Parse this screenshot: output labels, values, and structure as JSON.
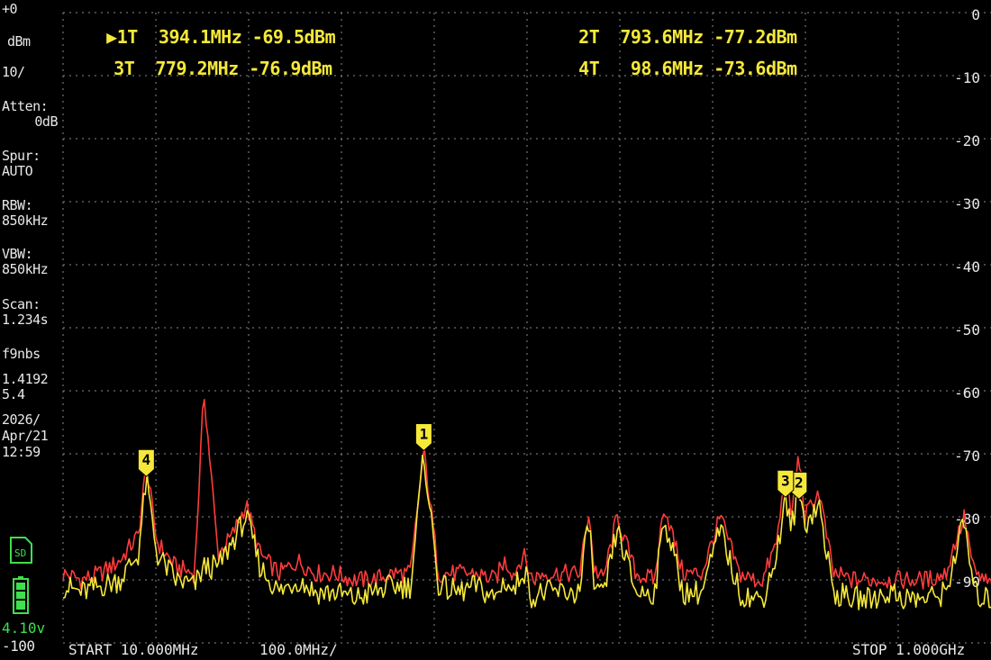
{
  "colors": {
    "background": "#000000",
    "grid": "#8a8a8a",
    "trace_yellow": "#f5e83a",
    "trace_red": "#ff3b3b",
    "marker_fill": "#f5e83a",
    "text": "#e8e8e8",
    "green": "#3ee04e"
  },
  "markers_header": [
    {
      "label": "1T",
      "freq": "394.1MHz",
      "level": "-69.5dBm",
      "selected": true
    },
    {
      "label": "2T",
      "freq": "793.6MHz",
      "level": "-77.2dBm"
    },
    {
      "label": "3T",
      "freq": "779.2MHz",
      "level": "-76.9dBm"
    },
    {
      "label": "4T",
      "freq": "98.6MHz",
      "level": "-73.6dBm"
    }
  ],
  "sidebar": {
    "ref_level": "+0",
    "unit": "dBm",
    "scale": "10/",
    "atten_label": "Atten:",
    "atten_value": "0dB",
    "spur_label": "Spur:",
    "spur_value": "AUTO",
    "rbw_label": "RBW:",
    "rbw_value": "850kHz",
    "vbw_label": "VBW:",
    "vbw_value": "850kHz",
    "scan_label": "Scan:",
    "scan_value": "1.234s",
    "misc_1": "f9nbs",
    "misc_2": "1.4192",
    "misc_3": "5.4",
    "date_1": "2026/",
    "date_2": "Apr/21",
    "time": "12:59",
    "sd_icon": "sd-card-icon",
    "battery_icon": "battery-icon",
    "voltage": "4.10v",
    "bottom_level": "-100"
  },
  "bottom": {
    "start": "START 10.000MHz",
    "span_div": "100.0MHz/",
    "stop": "STOP 1.000GHz"
  },
  "chart_data": {
    "type": "line",
    "x_unit": "MHz",
    "y_unit": "dBm",
    "xlim": [
      10,
      1000
    ],
    "ylim": [
      -100,
      0
    ],
    "grid": true,
    "y_tick_labels": [
      "0",
      "-10",
      "-20",
      "-30",
      "-40",
      "-50",
      "-60",
      "-70",
      "-80",
      "-90"
    ],
    "series": [
      {
        "color": "#ff3b3b",
        "x": [
          10,
          30,
          50,
          70,
          90,
          98.6,
          110,
          130,
          150,
          160,
          175,
          190,
          205,
          220,
          240,
          260,
          280,
          300,
          320,
          340,
          360,
          380,
          394.1,
          410,
          430,
          450,
          470,
          480,
          490,
          500,
          510,
          520,
          525,
          540,
          560,
          570,
          575,
          585,
          600,
          620,
          640,
          650,
          670,
          690,
          710,
          730,
          745,
          755,
          770,
          779.2,
          785,
          793.6,
          800,
          815,
          830,
          850,
          870,
          890,
          910,
          930,
          950,
          960,
          965,
          970,
          980,
          990,
          1000
        ],
        "y": [
          -89,
          -90,
          -89,
          -87,
          -83,
          -72,
          -84,
          -88,
          -89,
          -60,
          -86,
          -83,
          -78,
          -86,
          -89,
          -87,
          -89,
          -89,
          -90,
          -90,
          -89,
          -89,
          -69.5,
          -89,
          -89,
          -89,
          -90,
          -87,
          -89,
          -86,
          -90,
          -89,
          -89,
          -89,
          -89,
          -79,
          -88,
          -90,
          -80,
          -89,
          -90,
          -78,
          -89,
          -89,
          -80,
          -89,
          -90,
          -90,
          -84,
          -73,
          -80,
          -70,
          -80,
          -76,
          -89,
          -90,
          -90,
          -90,
          -90,
          -90,
          -89,
          -84,
          -82,
          -80,
          -89,
          -90,
          -91
        ]
      },
      {
        "color": "#f5e83a",
        "x": [
          10,
          30,
          50,
          70,
          90,
          98.6,
          110,
          130,
          150,
          160,
          175,
          190,
          205,
          220,
          240,
          260,
          280,
          300,
          320,
          340,
          360,
          380,
          394.1,
          410,
          430,
          450,
          470,
          480,
          490,
          500,
          510,
          520,
          525,
          540,
          560,
          570,
          575,
          585,
          600,
          620,
          640,
          650,
          670,
          690,
          710,
          730,
          745,
          755,
          770,
          779.2,
          785,
          793.6,
          800,
          815,
          830,
          850,
          870,
          890,
          910,
          930,
          950,
          960,
          965,
          970,
          980,
          990,
          1000
        ],
        "y": [
          -91,
          -92,
          -91,
          -90,
          -86,
          -74,
          -86,
          -90,
          -91,
          -88,
          -88,
          -84,
          -80,
          -88,
          -92,
          -90,
          -92,
          -92,
          -93,
          -92,
          -91,
          -91,
          -70,
          -91,
          -92,
          -91,
          -93,
          -90,
          -92,
          -88,
          -93,
          -92,
          -92,
          -92,
          -92,
          -80,
          -91,
          -93,
          -82,
          -92,
          -92,
          -80,
          -92,
          -92,
          -82,
          -92,
          -93,
          -93,
          -86,
          -77,
          -82,
          -76,
          -81,
          -78,
          -92,
          -93,
          -93,
          -92,
          -93,
          -93,
          -92,
          -86,
          -83,
          -81,
          -92,
          -93,
          -93
        ]
      }
    ],
    "markers": [
      {
        "n": "1",
        "x": 394.1,
        "y": -69.5
      },
      {
        "n": "2",
        "x": 793.6,
        "y": -77.2
      },
      {
        "n": "3",
        "x": 779.2,
        "y": -76.9
      },
      {
        "n": "4",
        "x": 98.6,
        "y": -73.6
      }
    ]
  }
}
